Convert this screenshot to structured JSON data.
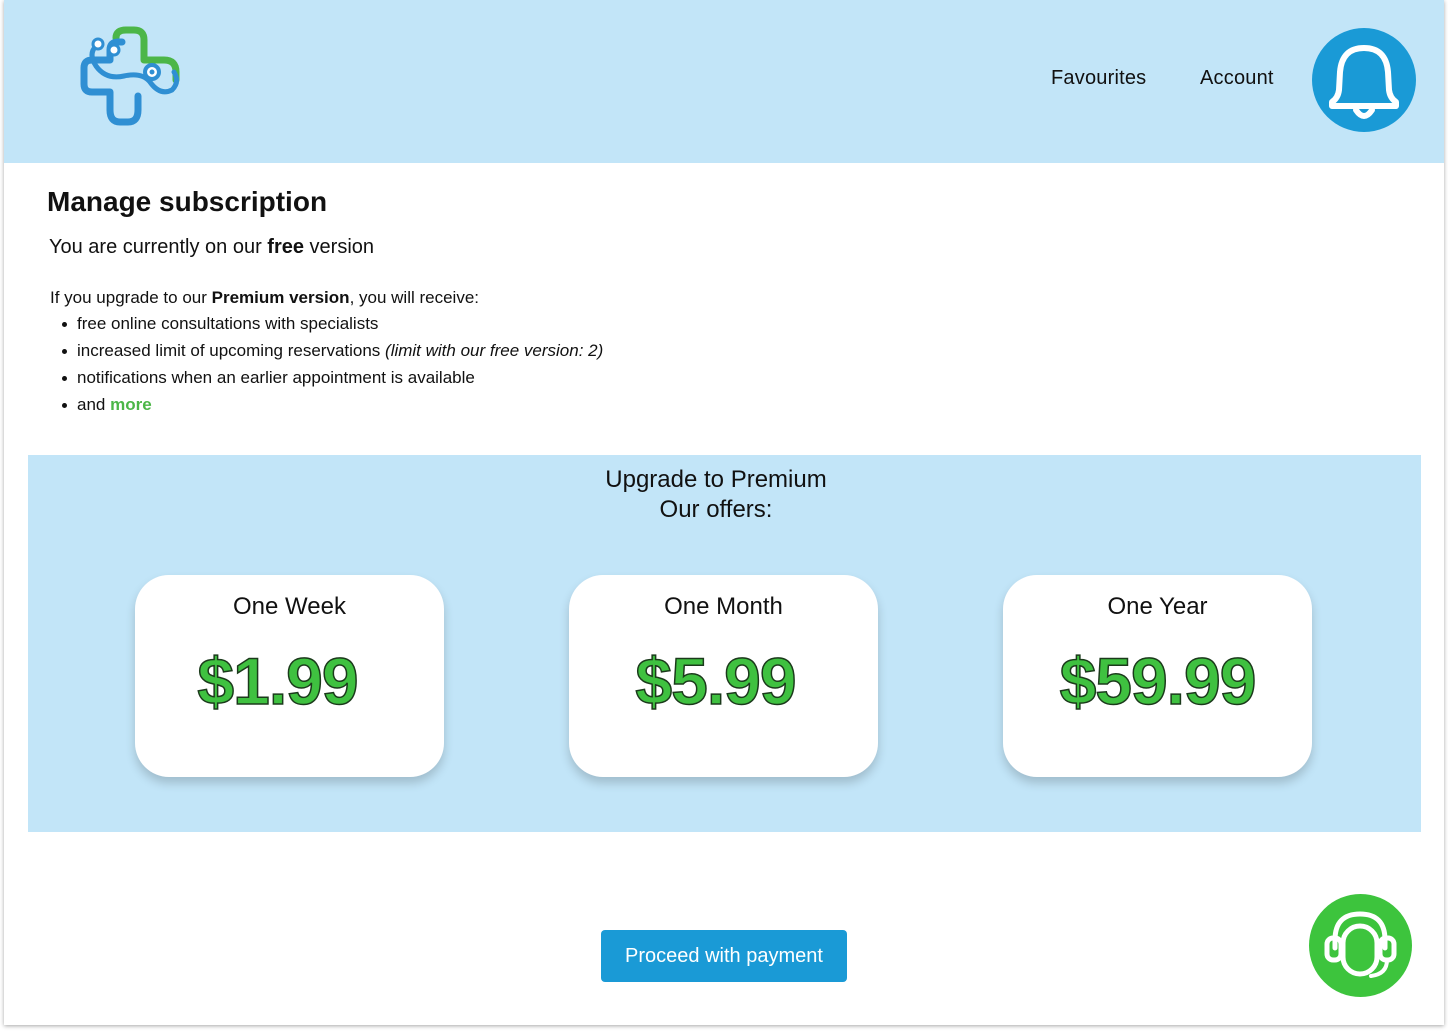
{
  "header": {
    "logo_icon": "medical-cross-stethoscope-logo",
    "nav": [
      {
        "label": "Favourites"
      },
      {
        "label": "Account"
      }
    ],
    "notification_icon": "bell-icon"
  },
  "main": {
    "title": "Manage subscription",
    "current_plan": {
      "prefix": "You are currently on our ",
      "plan": "free",
      "suffix": " version"
    },
    "upgrade_intro": {
      "prefix": "If you upgrade to our ",
      "emphasis": "Premium version",
      "suffix": ", you will receive:"
    },
    "benefits": [
      {
        "text": "free online consultations with specialists"
      },
      {
        "text": "increased limit of upcoming reservations ",
        "note": "(limit with our free version: 2)"
      },
      {
        "text": "notifications when an earlier appointment is available"
      },
      {
        "text": "and ",
        "link": "more"
      }
    ]
  },
  "offers": {
    "title": "Upgrade to Premium",
    "subtitle": "Our offers:",
    "plans": [
      {
        "label": "One Week",
        "price": "$1.99"
      },
      {
        "label": "One Month",
        "price": "$5.99"
      },
      {
        "label": "One Year",
        "price": "$59.99"
      }
    ]
  },
  "footer": {
    "pay_button": "Proceed with payment",
    "support_icon": "headset-support-icon"
  },
  "colors": {
    "header_bg": "#c2e5f8",
    "primary_blue": "#1a9ad6",
    "accent_green": "#3dc43d",
    "price_green": "#3fc140",
    "link_green": "#4cb648"
  }
}
